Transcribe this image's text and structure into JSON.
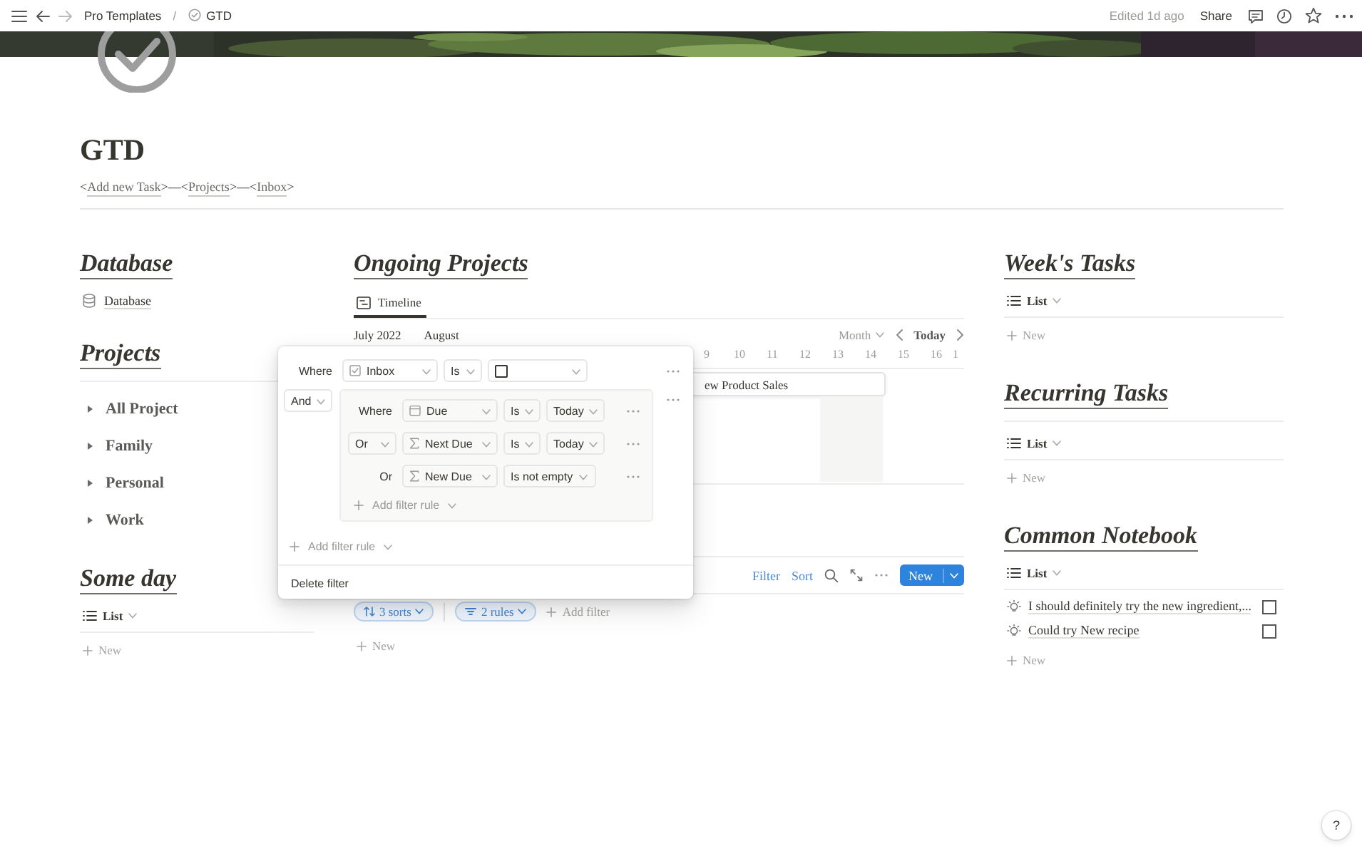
{
  "top_bar": {
    "breadcrumbs": [
      {
        "label": "Pro Templates",
        "kind": "plain"
      },
      {
        "label": "GTD",
        "kind": "page"
      }
    ],
    "separator": "/",
    "edited": "Edited 1d ago",
    "share": "Share"
  },
  "page": {
    "title": "GTD",
    "link_line": [
      {
        "kind": "text",
        "text": "<"
      },
      {
        "kind": "link",
        "text": "Add new Task"
      },
      {
        "kind": "text",
        "text": ">—<"
      },
      {
        "kind": "link",
        "text": "Projects"
      },
      {
        "kind": "text",
        "text": ">—<"
      },
      {
        "kind": "link",
        "text": "Inbox"
      },
      {
        "kind": "text",
        "text": ">"
      }
    ]
  },
  "left": [
    {
      "heading": "Database",
      "kind": "links",
      "items": [
        {
          "label": "Database"
        }
      ]
    },
    {
      "heading": "Projects",
      "kind": "toggles",
      "items": [
        {
          "label": "All Project",
          "expanded": false
        },
        {
          "label": "Family",
          "expanded": false
        },
        {
          "label": "Personal",
          "expanded": false
        },
        {
          "label": "Work",
          "expanded": false
        }
      ]
    },
    {
      "heading": "Some day",
      "kind": "list",
      "view": "List",
      "new": "New"
    }
  ],
  "middle": {
    "heading": "Ongoing Projects",
    "tab": "Timeline",
    "months": [
      "July 2022",
      "August"
    ],
    "scale": "Month",
    "today": "Today",
    "days": [
      "9",
      "10",
      "11",
      "12",
      "13",
      "14",
      "15",
      "16",
      "1"
    ],
    "bar": "ew Product Sales",
    "toolbar": {
      "filter": "Filter",
      "sort": "Sort",
      "new": "New"
    },
    "pills": [
      "3 sorts",
      "2 rules"
    ],
    "add_filter": "Add filter",
    "new": "New"
  },
  "right": [
    {
      "heading": "Week's Tasks",
      "kind": "list",
      "view": "List",
      "new": "New"
    },
    {
      "heading": "Recurring Tasks",
      "kind": "list",
      "view": "List",
      "new": "New"
    },
    {
      "heading": "Common Notebook",
      "kind": "list",
      "view": "List",
      "items": [
        {
          "label": "I should definitely try the new ingredient,...",
          "checked": false
        },
        {
          "label": "Could try New recipe",
          "checked": false
        }
      ],
      "new": "New"
    }
  ],
  "filter_popup": {
    "rules": [
      {
        "conjunction": {
          "text": "Where",
          "kind": "label"
        },
        "property": {
          "text": "Inbox",
          "kind": "checkbox"
        },
        "operator": "Is",
        "value": {
          "kind": "checkbox",
          "checked": false
        }
      }
    ],
    "group": {
      "conjunction": {
        "text": "And",
        "kind": "dropdown"
      },
      "rules": [
        {
          "conjunction": {
            "text": "Where",
            "kind": "label"
          },
          "property": {
            "text": "Due",
            "kind": "date"
          },
          "operator": "Is",
          "value": {
            "kind": "select",
            "text": "Today"
          }
        },
        {
          "conjunction": {
            "text": "Or",
            "kind": "dropdown"
          },
          "property": {
            "text": "Next Due",
            "kind": "formula"
          },
          "operator": "Is",
          "value": {
            "kind": "select",
            "text": "Today"
          }
        },
        {
          "conjunction": {
            "text": "Or",
            "kind": "label"
          },
          "property": {
            "text": "New Due",
            "kind": "formula"
          },
          "operator": "Is not empty"
        }
      ],
      "add_rule": "Add filter rule"
    },
    "add_rule": "Add filter rule",
    "delete": "Delete filter"
  },
  "help": "?"
}
